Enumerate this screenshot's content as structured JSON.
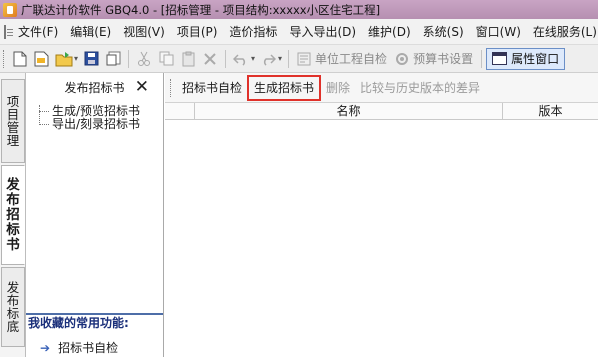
{
  "window": {
    "title": "广联达计价软件 GBQ4.0 - [招标管理 - 项目结构:xxxxx小区住宅工程]"
  },
  "menu": {
    "items": [
      {
        "label": "文件(F)"
      },
      {
        "label": "编辑(E)"
      },
      {
        "label": "视图(V)"
      },
      {
        "label": "项目(P)"
      },
      {
        "label": "造价指标"
      },
      {
        "label": "导入导出(D)"
      },
      {
        "label": "维护(D)"
      },
      {
        "label": "系统(S)"
      },
      {
        "label": "窗口(W)"
      },
      {
        "label": "在线服务(L)"
      }
    ]
  },
  "toolbar": {
    "unit_check_label": "单位工程自检",
    "budget_settings_label": "预算书设置",
    "properties_window_label": "属性窗口"
  },
  "vertical_tabs": [
    {
      "chars": [
        "项",
        "目",
        "管",
        "理"
      ],
      "active": false
    },
    {
      "chars": [
        "发",
        "布",
        "招",
        "标",
        "书"
      ],
      "active": true
    },
    {
      "chars": [
        "发",
        "布",
        "标",
        "底"
      ],
      "active": false
    }
  ],
  "left_panel": {
    "header": "发布招标书",
    "close_glyph": "✕",
    "tree": [
      {
        "label": "生成/预览招标书"
      },
      {
        "label": "导出/刻录招标书"
      }
    ],
    "favorites_title": "我收藏的常用功能:",
    "favorites": [
      {
        "label": "招标书自检"
      }
    ]
  },
  "right_panel": {
    "actions": {
      "self_check": "招标书自检",
      "generate": "生成招标书",
      "delete": "删除",
      "compare": "比较与历史版本的差异"
    },
    "table": {
      "col_name": "名称",
      "col_version": "版本"
    }
  },
  "colors": {
    "titlebar": "#b68fb1",
    "highlight": "#e0312a",
    "accent_blue": "#2f64c6"
  }
}
